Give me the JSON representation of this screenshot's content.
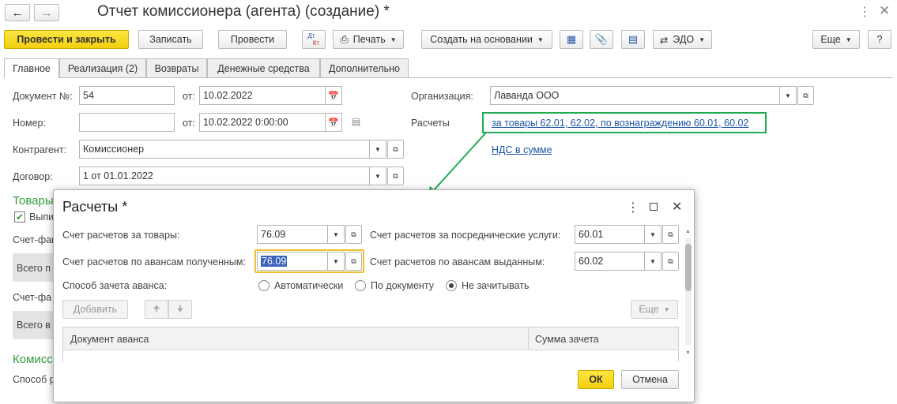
{
  "window": {
    "title": "Отчет комиссионера (агента) (создание) *"
  },
  "toolbar": {
    "post_close": "Провести и закрыть",
    "save": "Записать",
    "post": "Провести",
    "dtkt_top": "Дт",
    "dtkt_bottom": "Кт",
    "print": "Печать",
    "create_based": "Создать на основании",
    "edo": "ЭДО",
    "more": "Еще",
    "help": "?"
  },
  "tabs": [
    "Главное",
    "Реализация (2)",
    "Возвраты",
    "Денежные средства",
    "Дополнительно"
  ],
  "form": {
    "doc_num_label": "Документ №:",
    "doc_num": "54",
    "from_label": "от:",
    "doc_date": "10.02.2022",
    "number_label": "Номер:",
    "number": "",
    "from2_label": "от:",
    "number_date": "10.02.2022  0:00:00",
    "org_label": "Организация:",
    "org": "Лаванда ООО",
    "settlements_label": "Расчеты",
    "settlements_link": "за товары 62.01, 62.02, по вознаграждению 60.01, 60.02",
    "vat_link": "НДС в сумме",
    "counterparty_label": "Контрагент:",
    "counterparty": "Комиссионер",
    "contract_label": "Договор:",
    "contract": "1 от 01.01.2022",
    "goods_section": "Товары",
    "checkbox_label": "Выпи",
    "invoice1_label": "Счет-фак",
    "total1": "Всего п",
    "invoice2_label": "Счет-фа",
    "total2": "Всего в",
    "commission_section": "Комисс",
    "method_label": "Способ р"
  },
  "colors": {
    "accent_yellow": "#f5d31a",
    "highlight_green": "#1eaa50",
    "link_blue": "#1d56a8",
    "section_green": "#2f9a3c"
  },
  "dialog": {
    "title": "Расчеты *",
    "goods_account_label": "Счет расчетов за товары:",
    "goods_account": "76.09",
    "intermediary_label": "Счет расчетов за посреднические услуги:",
    "intermediary": "60.01",
    "advances_received_label": "Счет расчетов по авансам полученным:",
    "advances_received": "76.09",
    "advances_issued_label": "Счет расчетов по авансам выданным:",
    "advances_issued": "60.02",
    "offset_label": "Способ зачета аванса:",
    "offset_options": [
      "Автоматически",
      "По документу",
      "Не зачитывать"
    ],
    "offset_selected": "Не зачитывать",
    "add_button": "Добавить",
    "more_button": "Еще",
    "table_headers": [
      "Документ аванса",
      "Сумма зачета"
    ],
    "ok_button": "ОК",
    "cancel_button": "Отмена"
  }
}
